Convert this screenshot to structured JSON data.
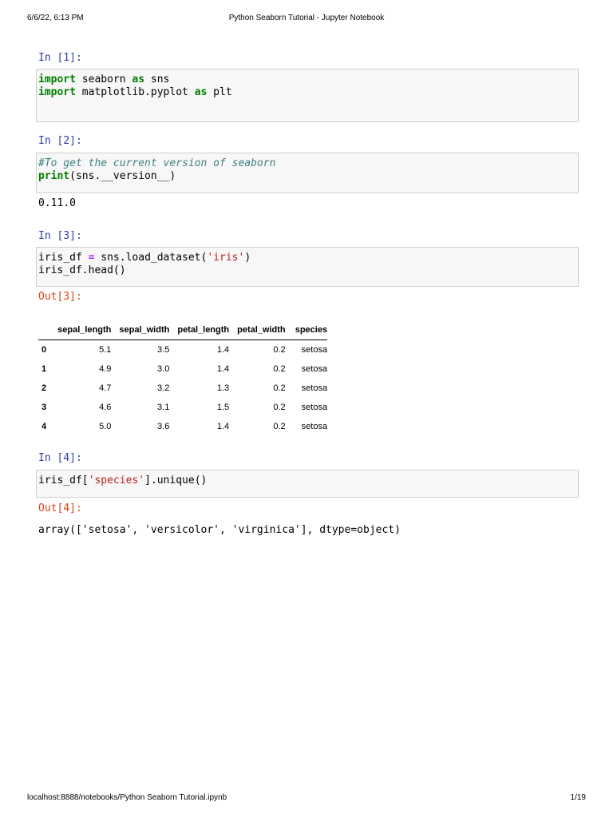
{
  "header": {
    "datetime": "6/6/22, 6:13 PM",
    "title": "Python Seaborn Tutorial - Jupyter Notebook"
  },
  "cells": [
    {
      "prompt": "In [1]:"
    },
    {
      "prompt": "In [2]:",
      "output": "0.11.0"
    },
    {
      "prompt": "In [3]:",
      "out_prompt": "Out[3]:"
    },
    {
      "prompt": "In [4]:",
      "out_prompt": "Out[4]:",
      "output": "array(['setosa', 'versicolor', 'virginica'], dtype=object)"
    }
  ],
  "table": {
    "columns": [
      "sepal_length",
      "sepal_width",
      "petal_length",
      "petal_width",
      "species"
    ],
    "rows": [
      {
        "index": "0",
        "values": [
          "5.1",
          "3.5",
          "1.4",
          "0.2",
          "setosa"
        ]
      },
      {
        "index": "1",
        "values": [
          "4.9",
          "3.0",
          "1.4",
          "0.2",
          "setosa"
        ]
      },
      {
        "index": "2",
        "values": [
          "4.7",
          "3.2",
          "1.3",
          "0.2",
          "setosa"
        ]
      },
      {
        "index": "3",
        "values": [
          "4.6",
          "3.1",
          "1.5",
          "0.2",
          "setosa"
        ]
      },
      {
        "index": "4",
        "values": [
          "5.0",
          "3.6",
          "1.4",
          "0.2",
          "setosa"
        ]
      }
    ]
  },
  "code": {
    "c1": {
      "import": "import",
      "seaborn": " seaborn ",
      "as": "as",
      "sns": " sns",
      "import2": "import",
      "mpl": " matplotlib.pyplot ",
      "as2": "as",
      "plt": " plt"
    },
    "c2": {
      "comment": "#To get the current version of seaborn",
      "print": "print",
      "rest": "(sns.__version__)"
    },
    "c3": {
      "a": "iris_df ",
      "eq": "=",
      "b": " sns.load_dataset(",
      "s": "'iris'",
      "c": ")",
      "line2": "iris_df.head()"
    },
    "c4": {
      "a": "iris_df[",
      "s": "'species'",
      "b": "].unique()"
    }
  },
  "footer": {
    "url": "localhost:8888/notebooks/Python Seaborn Tutorial.ipynb",
    "page": "1/19"
  }
}
